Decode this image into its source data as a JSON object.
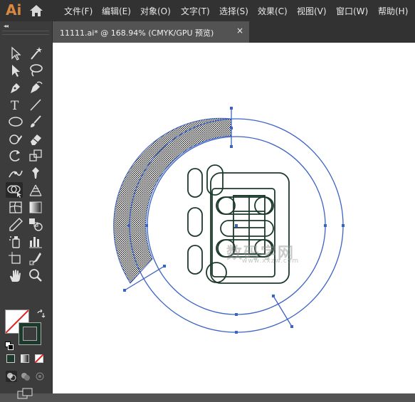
{
  "app": {
    "logo": "Ai"
  },
  "menu": [
    "文件(F)",
    "编辑(E)",
    "对象(O)",
    "文字(T)",
    "选择(S)",
    "效果(C)",
    "视图(V)",
    "窗口(W)",
    "帮助(H)"
  ],
  "tab": {
    "title": "11111.ai* @ 168.94% (CMYK/GPU 预览)",
    "close": "×"
  },
  "toolbar": {
    "collapse": "◂◂",
    "tools": [
      "selection-tool",
      "direct-selection-tool",
      "magic-wand-tool",
      "lasso-tool",
      "pen-tool",
      "curvature-tool",
      "type-tool",
      "line-segment-tool",
      "ellipse-tool",
      "paintbrush-tool",
      "shaper-tool",
      "eraser-tool",
      "rotate-tool",
      "scale-tool",
      "width-tool",
      "puppet-warp-tool",
      "shape-builder-tool",
      "perspective-grid-tool",
      "mesh-tool",
      "gradient-tool",
      "eyedropper-tool",
      "blend-tool",
      "symbol-sprayer-tool",
      "column-graph-tool",
      "artboard-tool",
      "slice-tool",
      "hand-tool",
      "zoom-tool"
    ],
    "active_tool": "shape-builder-tool"
  },
  "colors": {
    "fill": "#ffffff",
    "stroke": "#1c3a2c",
    "selection": "#3b63c4",
    "path": "#1c3a2c",
    "menubar": "#323232",
    "toolbar": "#3c3c3c"
  },
  "watermark": {
    "text": "数码字网",
    "sub": "www.xxzw.com"
  }
}
